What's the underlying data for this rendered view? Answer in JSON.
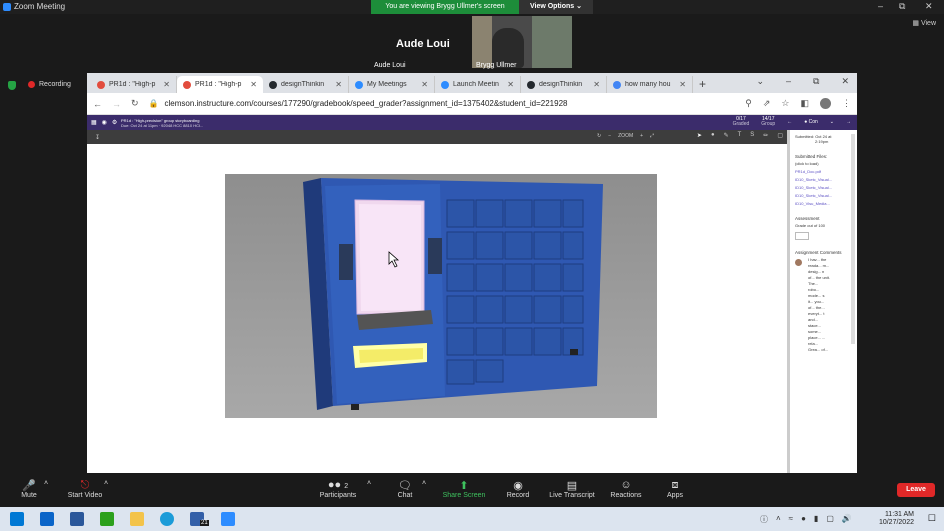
{
  "zoom": {
    "window_title": "Zoom Meeting",
    "banner_text": "You are viewing Brygg Ullmer's screen",
    "view_options": "View Options",
    "view_button": "View",
    "active_speaker": "Aude Loui",
    "thumb_name_left": "Aude Loui",
    "thumb_name_right": "Brygg Ullmer",
    "recording": "Recording",
    "controls": {
      "mute": "Mute",
      "start_video": "Start Video",
      "participants": "Participants",
      "participants_count": "2",
      "chat": "Chat",
      "share_screen": "Share Screen",
      "record": "Record",
      "live_transcript": "Live Transcript",
      "reactions": "Reactions",
      "apps": "Apps",
      "leave": "Leave"
    }
  },
  "browser": {
    "tabs": [
      {
        "label": "PR1d : \"High-p",
        "icon_color": "#e24c3d",
        "icon": "canvas-icon"
      },
      {
        "label": "PR1d : \"High-p",
        "icon_color": "#e24c3d",
        "icon": "canvas-icon"
      },
      {
        "label": "designThinkin",
        "icon_color": "#24292e",
        "icon": "github-icon"
      },
      {
        "label": "My Meetings",
        "icon_color": "#2d8cff",
        "icon": "zoom-icon"
      },
      {
        "label": "Launch Meetin",
        "icon_color": "#2d8cff",
        "icon": "zoom-icon"
      },
      {
        "label": "designThinkin",
        "icon_color": "#24292e",
        "icon": "github-icon"
      },
      {
        "label": "how many hou",
        "icon_color": "#4285f4",
        "icon": "google-icon"
      }
    ],
    "url": "clemson.instructure.com/courses/177290/gradebook/speed_grader?assignment_id=1375402&student_id=221928"
  },
  "speedgrader": {
    "header_title": "PR1d : \"High-precision\" group storyboarding",
    "header_sub": "Due: Oct 24 at 11pm · 92048 HCC 8810 HCI...",
    "graded": "0/17",
    "graded_label": "Graded",
    "count": "14/17",
    "count_label": "Group",
    "student": "Con",
    "zoom_label": "ZOOM",
    "submitted_label": "Submitted: Oct 24 at",
    "submitted_time": "2:19pm",
    "files_head": "Submitted Files:",
    "files_sub": "(click to load)",
    "files": [
      "PR1d_Doc.pdf",
      "ID10_Sketc_Visual...",
      "ID10_Sketc_Visual...",
      "ID10_Sketc_Visual...",
      "ID10_Visu_Media..."
    ],
    "assessment_head": "Assessment",
    "assessment_sub": "Grade out of 100",
    "comments_head": "Assignment Comments",
    "comment_text": "I hav... the reada... m... desig... n of... the unit. The... robo... mode... s it... you... of... the... everyt... t and... stace... some... place... ... rela... Grea... of..."
  },
  "taskbar": {
    "time": "11:31 AM",
    "date": "10/27/2022",
    "badge": "21"
  },
  "colors": {
    "zoom_green": "#1d8d3a",
    "canvas_purple": "#3b2c6b",
    "leave_red": "#e02828"
  }
}
